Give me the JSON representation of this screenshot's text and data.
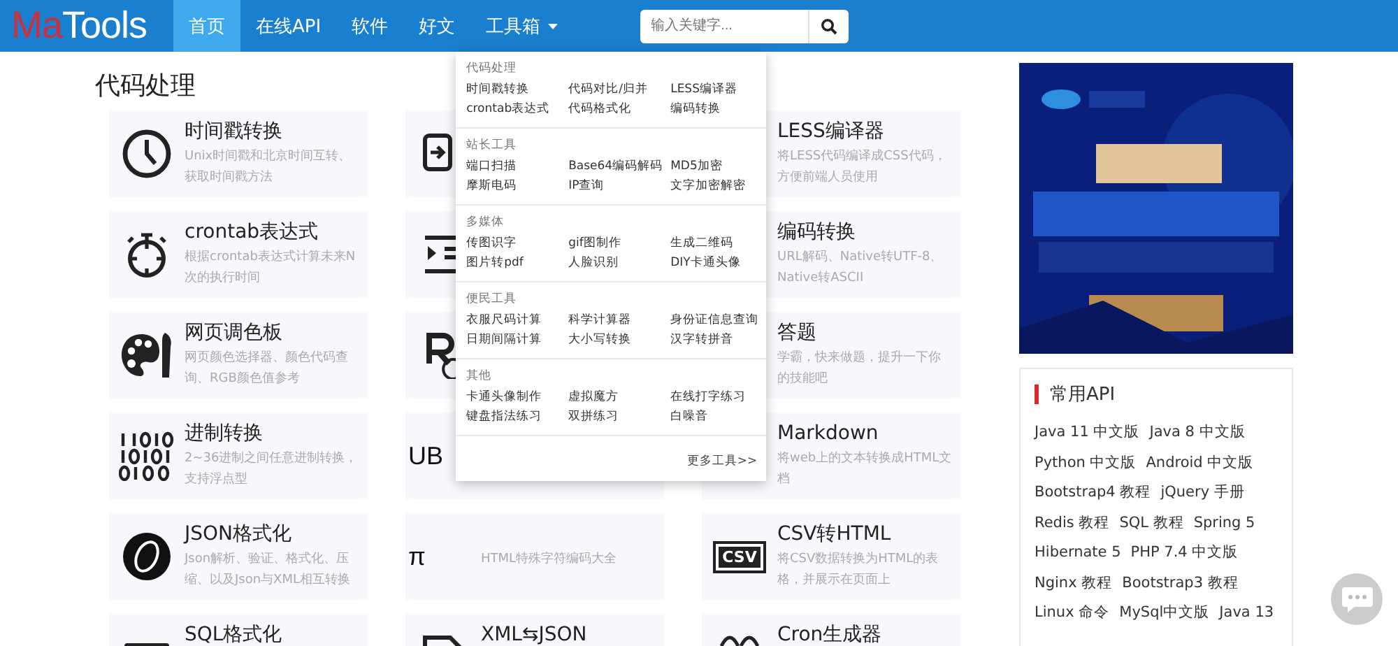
{
  "nav": {
    "logo": [
      {
        "text": "Ma",
        "kind": "accent"
      },
      {
        "text": "Tools",
        "kind": "plain"
      }
    ],
    "items": [
      {
        "label": "首页",
        "selected": true,
        "caret": false
      },
      {
        "label": "在线API",
        "selected": false,
        "caret": false
      },
      {
        "label": "软件",
        "selected": false,
        "caret": false
      },
      {
        "label": "好文",
        "selected": false,
        "caret": false
      },
      {
        "label": "工具箱",
        "selected": false,
        "caret": true
      }
    ],
    "search": {
      "placeholder": "输入关键字..."
    }
  },
  "dropdown": {
    "sections": [
      {
        "heading": "代码处理",
        "items": [
          "时间戳转换",
          "代码对比/归并",
          "LESS编译器",
          "crontab表达式",
          "代码格式化",
          "编码转换"
        ]
      },
      {
        "heading": "站长工具",
        "items": [
          "端口扫描",
          "Base64编码解码",
          "MD5加密",
          "摩斯电码",
          "IP查询",
          "文字加密解密"
        ]
      },
      {
        "heading": "多媒体",
        "items": [
          "传图识字",
          "gif图制作",
          "生成二维码",
          "图片转pdf",
          "人脸识别",
          "DIY卡通头像"
        ]
      },
      {
        "heading": "便民工具",
        "items": [
          "衣服尺码计算",
          "科学计算器",
          "身份证信息查询",
          "日期间隔计算",
          "大小写转换",
          "汉字转拼音"
        ]
      },
      {
        "heading": "其他",
        "items": [
          "卡通头像制作",
          "虚拟魔方",
          "在线打字练习",
          "键盘指法练习",
          "双拼练习",
          "白噪音"
        ]
      }
    ],
    "more": "更多工具>>"
  },
  "section": {
    "title": "代码处理",
    "cards": [
      {
        "kind": "clock",
        "title": "时间戳转换",
        "desc": "Unix时间戳和北京时间互转、获取时间戳方法"
      },
      {
        "kind": "compare"
      },
      {
        "title": "LESS编译器",
        "desc": "将LESS代码编译成CSS代码，方便前端人员使用"
      },
      {
        "kind": "stopwatch",
        "title": "crontab表达式",
        "desc": "根据crontab表达式计算未来N次的执行时间"
      },
      {
        "kind": "indent"
      },
      {
        "title": "编码转换",
        "desc": "URL解码、Native转UTF-8、Native转ASCII"
      },
      {
        "kind": "palette",
        "title": "网页调色板",
        "desc": "网页颜色选择器、颜色代码查询、RGB颜色值参考"
      },
      {
        "kind": "rgb"
      },
      {
        "title": "答题",
        "desc": "学霸，快来做题，提升一下你的技能吧"
      },
      {
        "kind": "binary",
        "title": "进制转换",
        "desc": "2~36进制之间任意进制转换，支持浮点型"
      },
      {
        "kind": "glyph",
        "icon_text": "UB"
      },
      {
        "title": "Markdown",
        "desc": "将web上的文本转换成HTML文档"
      },
      {
        "kind": "json",
        "title": "JSON格式化",
        "desc": "Json解析、验证、格式化、压缩、以及Json与XML相互转换"
      },
      {
        "kind": "glyph",
        "icon_text": "π",
        "desc": "HTML特殊字符编码大全"
      },
      {
        "kind": "badge",
        "icon_text": "CSV",
        "title": "CSV转HTML",
        "desc": "将CSV数据转换为HTML的表格，并展示在页面上"
      },
      {
        "kind": "sql",
        "title": "SQL格式化"
      },
      {
        "kind": "file",
        "title": "XML⇆JSON"
      },
      {
        "kind": "cron",
        "title": "Cron生成器"
      }
    ]
  },
  "api": {
    "title": "常用API",
    "links": [
      "Java 11 中文版",
      "Java 8 中文版",
      "Python 中文版",
      "Android 中文版",
      "Bootstrap4 教程",
      "jQuery 手册",
      "Redis 教程",
      "SQL 教程",
      "Spring 5",
      "Hibernate 5",
      "PHP 7.4 中文版",
      "Nginx 教程",
      "Bootstrap3 教程",
      "Linux 命令",
      "MySql中文版",
      "Java 13"
    ]
  }
}
